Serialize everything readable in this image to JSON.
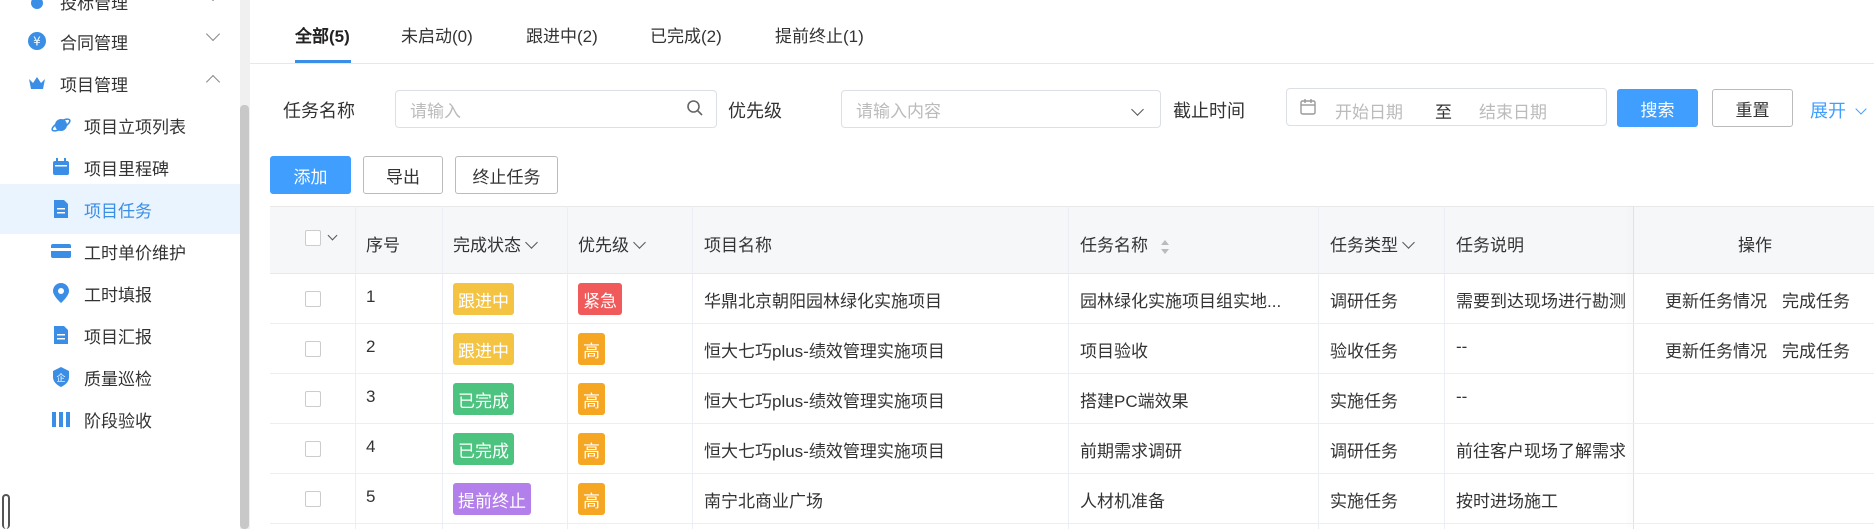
{
  "sidebar": {
    "items": [
      {
        "label": "投标管理",
        "level": "top",
        "icon": "medal-icon",
        "expanded": false
      },
      {
        "label": "合同管理",
        "level": "top",
        "icon": "yuan-icon",
        "expanded": false
      },
      {
        "label": "项目管理",
        "level": "top",
        "icon": "crown-icon",
        "expanded": true
      },
      {
        "label": "项目立项列表",
        "level": "sub",
        "icon": "planet-icon"
      },
      {
        "label": "项目里程碑",
        "level": "sub",
        "icon": "calendar-icon"
      },
      {
        "label": "项目任务",
        "level": "sub",
        "icon": "document-icon",
        "active": true
      },
      {
        "label": "工时单价维护",
        "level": "sub",
        "icon": "card-icon"
      },
      {
        "label": "工时填报",
        "level": "sub",
        "icon": "location-icon"
      },
      {
        "label": "项目汇报",
        "level": "sub",
        "icon": "document-icon"
      },
      {
        "label": "质量巡检",
        "level": "sub",
        "icon": "shield-icon"
      },
      {
        "label": "阶段验收",
        "level": "sub",
        "icon": "bars-icon"
      }
    ]
  },
  "tabs": [
    {
      "label": "全部(5)",
      "active": true
    },
    {
      "label": "未启动(0)"
    },
    {
      "label": "跟进中(2)"
    },
    {
      "label": "已完成(2)"
    },
    {
      "label": "提前终止(1)"
    }
  ],
  "filters": {
    "task_name_label": "任务名称",
    "task_name_placeholder": "请输入",
    "priority_label": "优先级",
    "priority_placeholder": "请输入内容",
    "deadline_label": "截止时间",
    "start_placeholder": "开始日期",
    "range_sep": "至",
    "end_placeholder": "结束日期",
    "search_button": "搜索",
    "reset_button": "重置",
    "expand_link": "展开"
  },
  "toolbar": {
    "add_button": "添加",
    "export_button": "导出",
    "terminate_button": "终止任务"
  },
  "table": {
    "headers": {
      "index": "序号",
      "status": "完成状态",
      "priority": "优先级",
      "project": "项目名称",
      "task": "任务名称",
      "type": "任务类型",
      "desc": "任务说明",
      "ops": "操作"
    },
    "rows": [
      {
        "index": "1",
        "status": "跟进中",
        "priority": "紧急",
        "project": "华鼎北京朝阳园林绿化实施项目",
        "task": "园林绿化实施项目组实地...",
        "type": "调研任务",
        "desc": "需要到达现场进行勘测",
        "op1": "更新任务情况",
        "op2": "完成任务"
      },
      {
        "index": "2",
        "status": "跟进中",
        "priority": "高",
        "project": "恒大七巧plus-绩效管理实施项目",
        "task": "项目验收",
        "type": "验收任务",
        "desc": "--",
        "op1": "更新任务情况",
        "op2": "完成任务"
      },
      {
        "index": "3",
        "status": "已完成",
        "priority": "高",
        "project": "恒大七巧plus-绩效管理实施项目",
        "task": "搭建PC端效果",
        "type": "实施任务",
        "desc": "--",
        "op1": "",
        "op2": ""
      },
      {
        "index": "4",
        "status": "已完成",
        "priority": "高",
        "project": "恒大七巧plus-绩效管理实施项目",
        "task": "前期需求调研",
        "type": "调研任务",
        "desc": "前往客户现场了解需求",
        "op1": "",
        "op2": ""
      },
      {
        "index": "5",
        "status": "提前终止",
        "priority": "高",
        "project": "南宁北商业广场",
        "task": "人材机准备",
        "type": "实施任务",
        "desc": "按时进场施工",
        "op1": "",
        "op2": ""
      }
    ]
  },
  "colors": {
    "primary": "#409eff",
    "status_following": "#f5c342",
    "status_done": "#4cc47f",
    "status_terminated": "#b37feb",
    "priority_urgent": "#f05a5a",
    "priority_high": "#f5a623"
  }
}
